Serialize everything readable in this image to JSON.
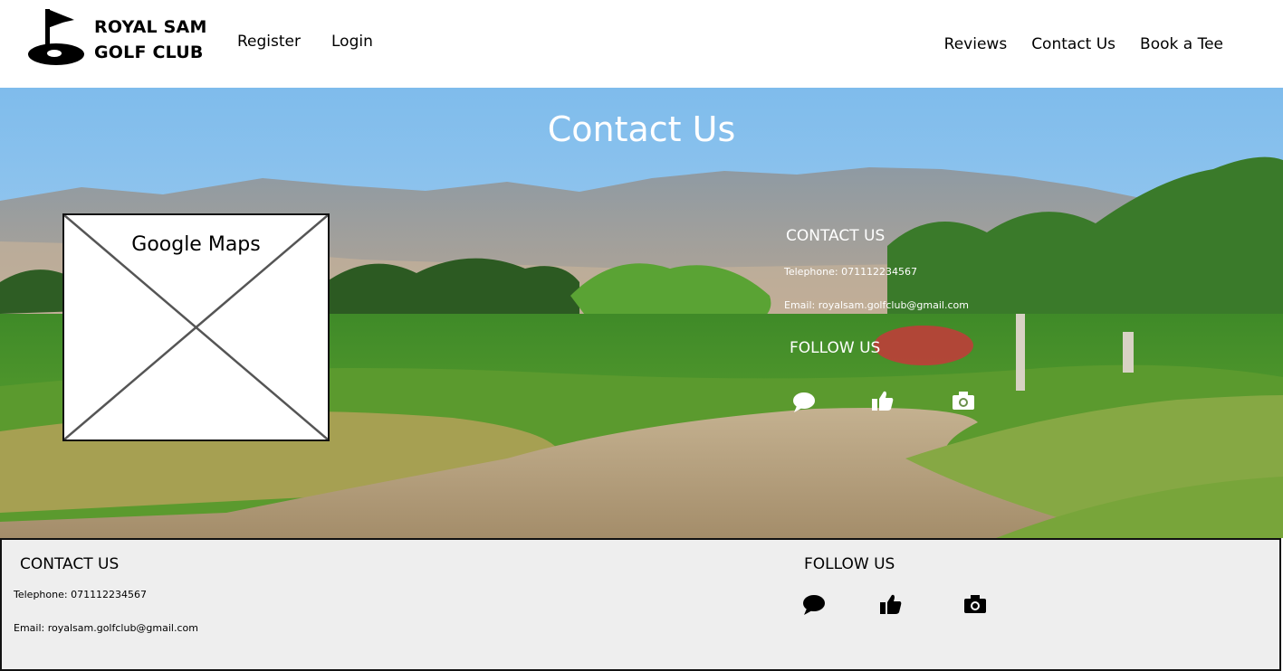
{
  "brand": {
    "line1": "ROYAL SAM",
    "line2": "GOLF CLUB",
    "logo_icon": "golf-flag-icon"
  },
  "nav": {
    "left": [
      "Register",
      "Login"
    ],
    "right": [
      "Reviews",
      "Contact Us",
      "Book a Tee"
    ]
  },
  "hero": {
    "title": "Contact Us",
    "map_label": "Google Maps",
    "contact_heading": "CONTACT US",
    "telephone": "Telephone: 071112234567",
    "email": "Email: royalsam.golfclub@gmail.com",
    "follow_heading": "FOLLOW US",
    "social_icons": [
      "chat-icon",
      "thumbs-up-icon",
      "camera-icon"
    ]
  },
  "footer": {
    "contact_heading": "CONTACT US",
    "telephone": "Telephone: 071112234567",
    "email": "Email: royalsam.golfclub@gmail.com",
    "follow_heading": "FOLLOW US",
    "social_icons": [
      "chat-icon",
      "thumbs-up-icon",
      "camera-icon"
    ]
  },
  "colors": {
    "header_bg": "#ffffff",
    "footer_bg": "#eeeeee",
    "hero_text": "#ffffff",
    "sky": "#8ec4ee",
    "grass": "#5fa531",
    "sand": "#b5a07c"
  }
}
